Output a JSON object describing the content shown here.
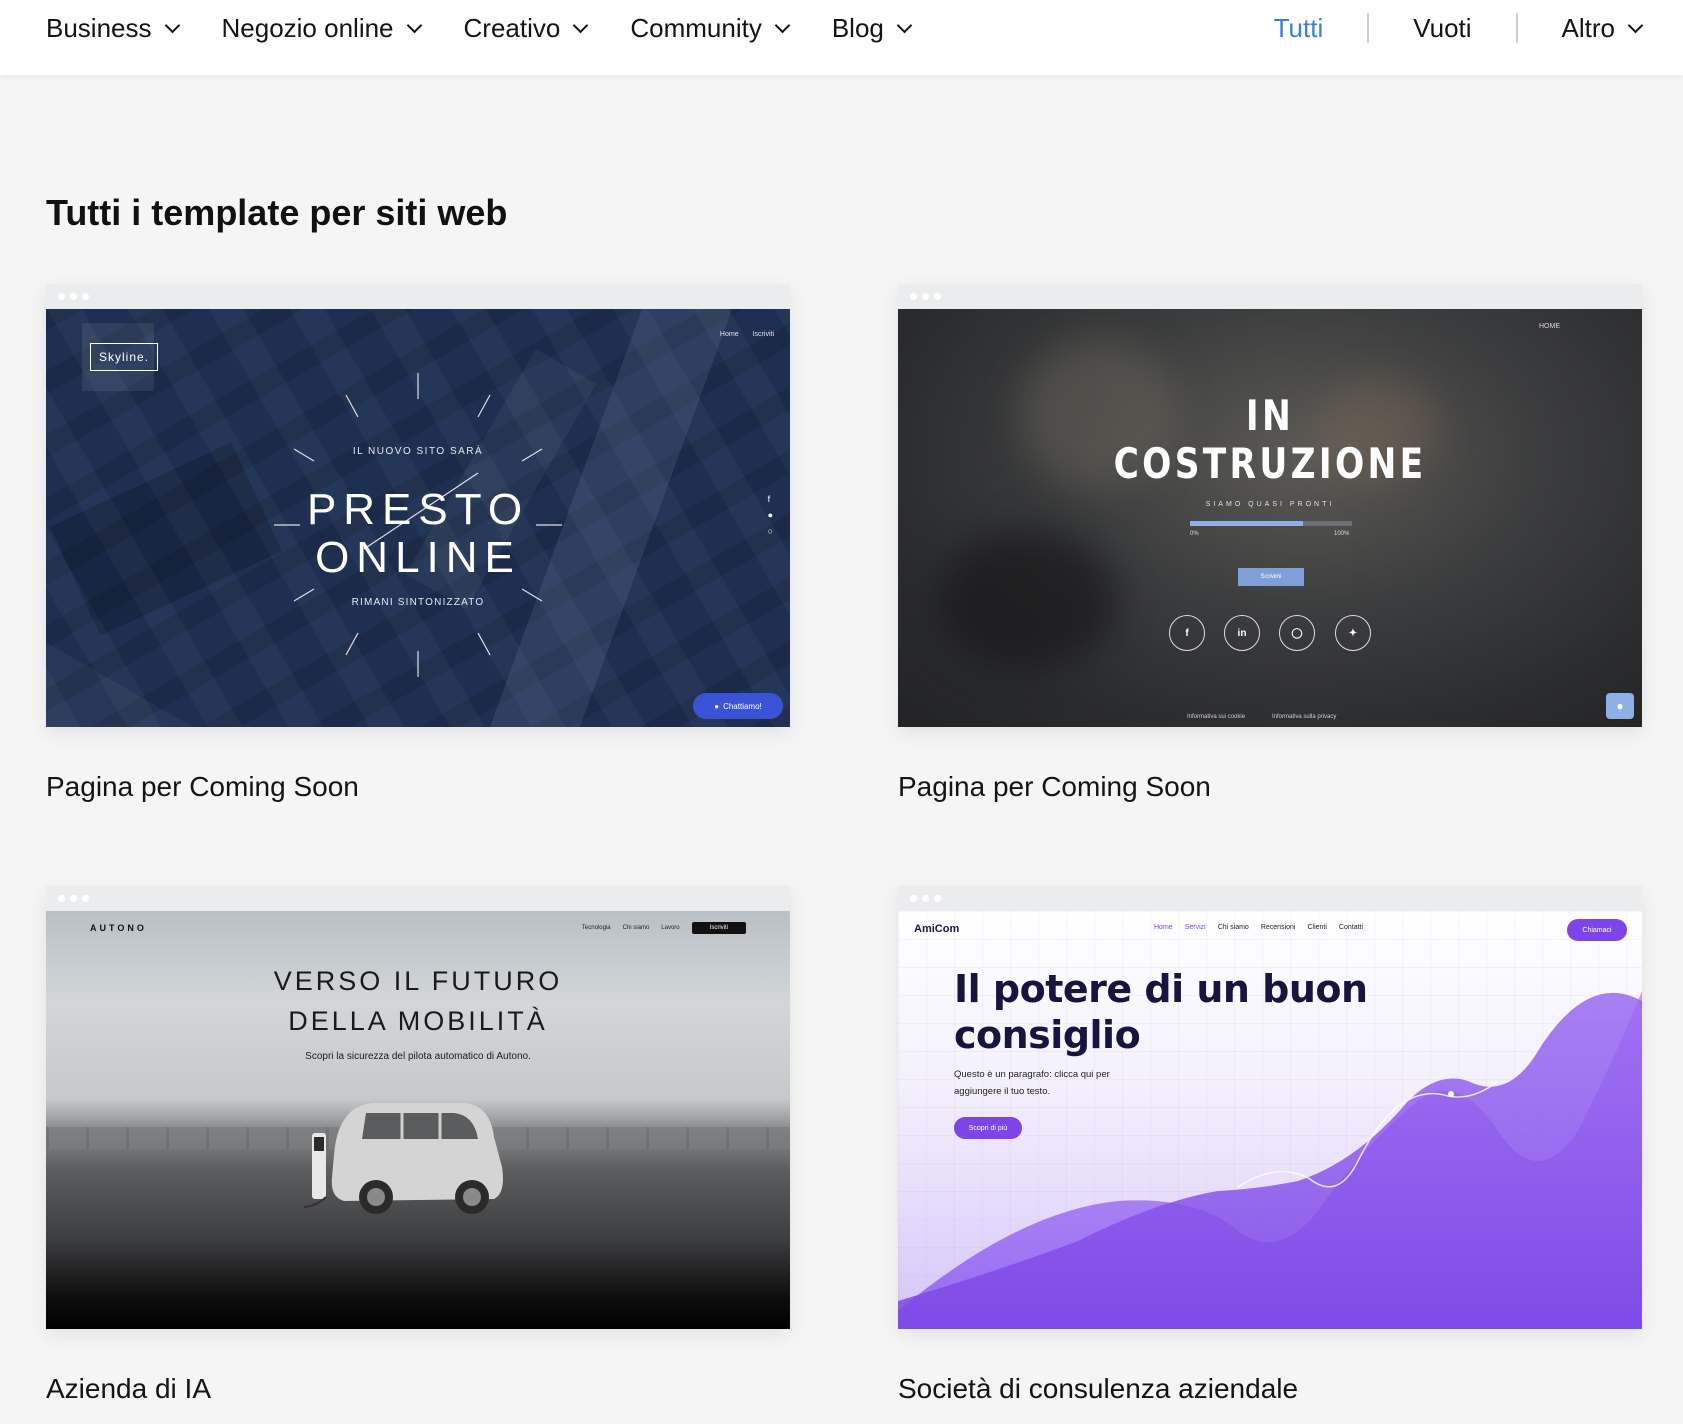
{
  "nav": {
    "left": [
      {
        "label": "Business"
      },
      {
        "label": "Negozio online"
      },
      {
        "label": "Creativo"
      },
      {
        "label": "Community"
      },
      {
        "label": "Blog"
      }
    ],
    "right": {
      "all": "Tutti",
      "blank": "Vuoti",
      "more": "Altro"
    }
  },
  "section_title": "Tutti i template per siti web",
  "cards": [
    {
      "title": "Pagina per Coming Soon",
      "preview": {
        "logo": "Skyline.",
        "nav": [
          "Home",
          "Iscriviti"
        ],
        "kicker": "IL NUOVO SITO SARÀ",
        "headline_1": "PRESTO",
        "headline_2": "ONLINE",
        "sub": "RIMANI SINTONIZZATO",
        "chat": "Chattiamo!"
      }
    },
    {
      "title": "Pagina per Coming Soon",
      "preview": {
        "nav": "HOME",
        "headline_1": "IN",
        "headline_2": "COSTRUZIONE",
        "sub": "SIAMO QUASI PRONTI",
        "progress": 0.7,
        "pct_start": "0%",
        "pct_end": "100%",
        "button": "Scrivimi",
        "footer_1": "Informativa sui cookie",
        "footer_2": "Informativa sulla privacy"
      }
    },
    {
      "title": "Azienda di IA",
      "preview": {
        "brand": "AUTONO",
        "nav": [
          "Tecnologia",
          "Chi siamo",
          "Lavoro"
        ],
        "cta": "Iscriviti",
        "headline_1": "VERSO IL FUTURO",
        "headline_2": "DELLA MOBILITÀ",
        "sub": "Scopri la sicurezza del pilota automatico di Autono."
      }
    },
    {
      "title": "Società di consulenza aziendale",
      "preview": {
        "brand": "AmiCom",
        "nav": [
          "Home",
          "Servizi",
          "Chi siamo",
          "Recensioni",
          "Clienti",
          "Contatti"
        ],
        "cta": "Chiamaci",
        "headline": "Il potere di un buon consiglio",
        "paragraph": "Questo è un paragrafo: clicca qui per aggiungere il tuo testo.",
        "button": "Scopri di più"
      }
    }
  ],
  "colors": {
    "accent": "#3b7ddd",
    "page_bg": "#f4f5f4",
    "purple": "#7d44e8",
    "navy": "#1d3052"
  },
  "icons": [
    "chevron-down-icon",
    "facebook-icon",
    "twitter-icon",
    "instagram-icon",
    "linkedin-icon",
    "chat-icon"
  ]
}
